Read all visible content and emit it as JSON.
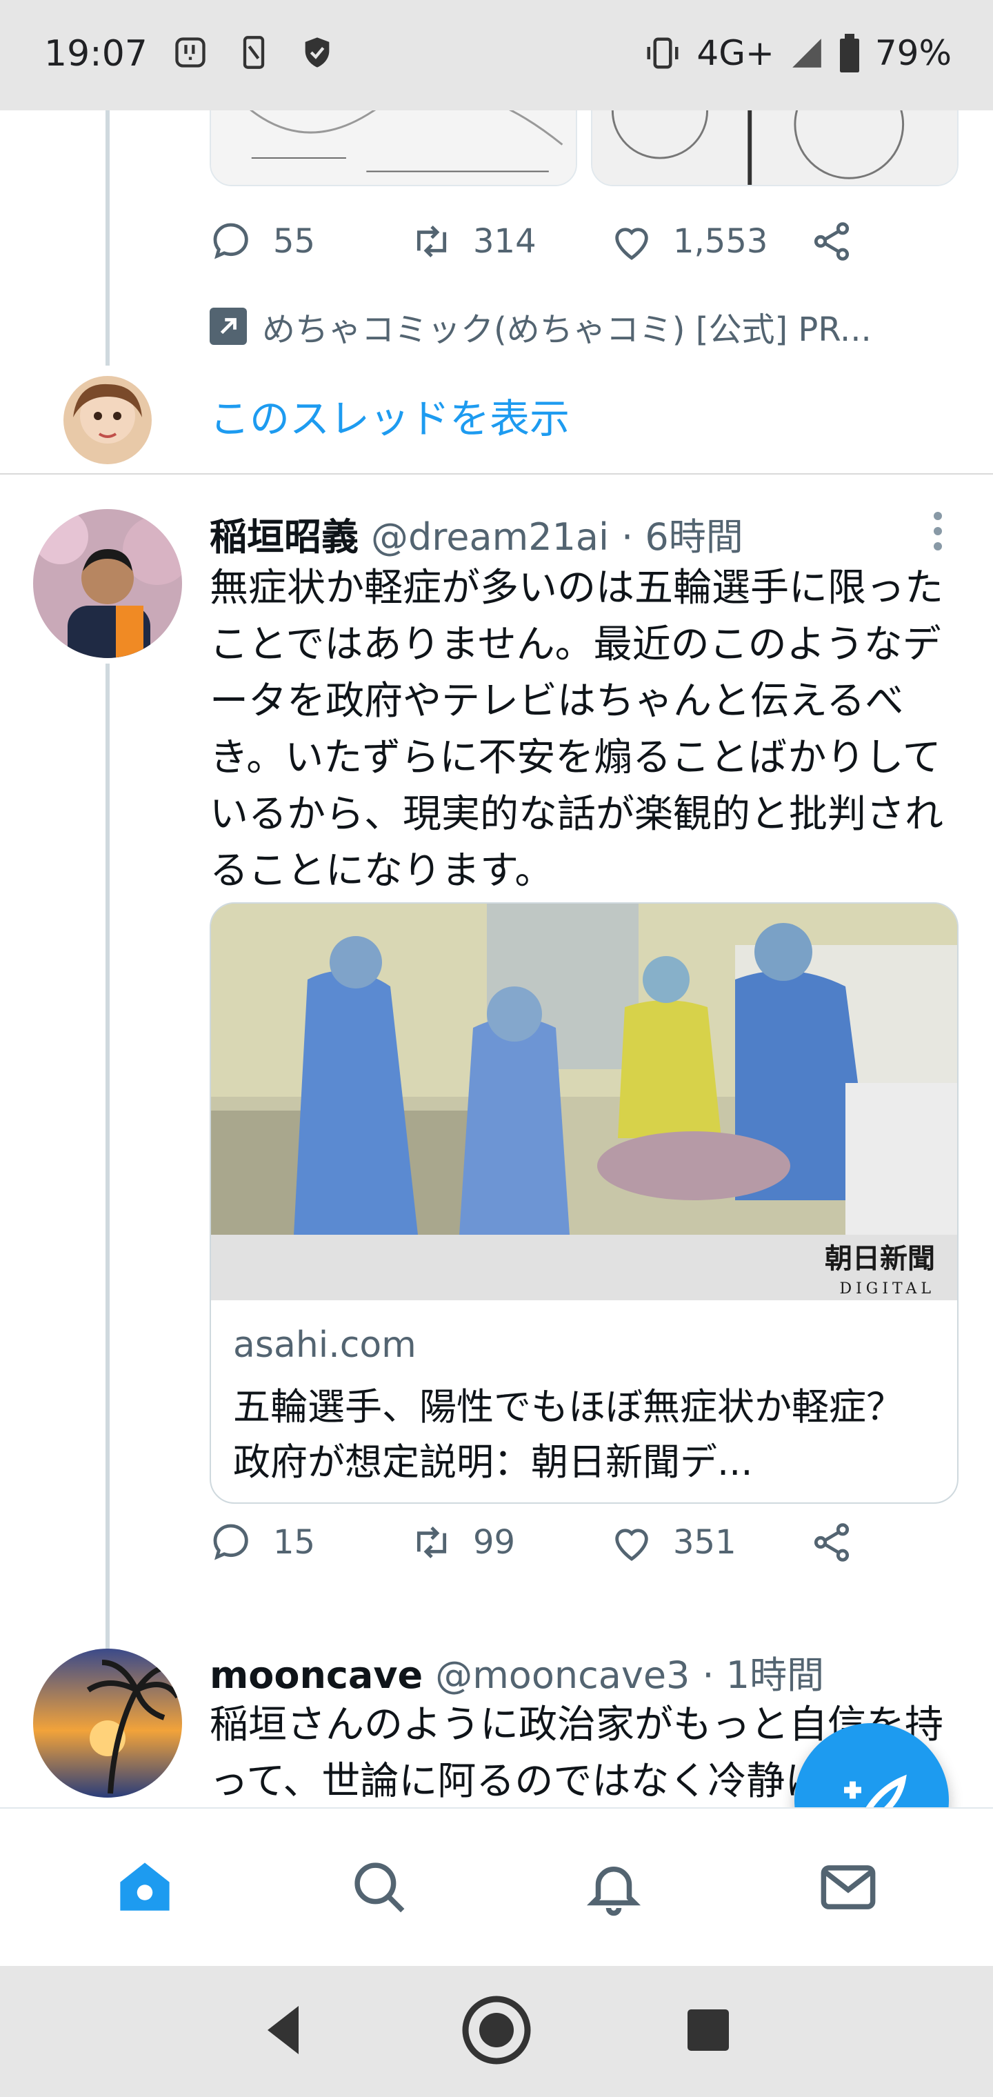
{
  "status_bar": {
    "time": "19:07",
    "network": "4G+",
    "battery": "79%",
    "left_icons": [
      "notification-icon",
      "sim-icon",
      "shield-icon"
    ],
    "right_icons": [
      "vibrate-icon",
      "signal-icon",
      "battery-icon"
    ]
  },
  "prev_tweet": {
    "replies": "55",
    "retweets": "314",
    "likes": "1,553",
    "promoted_by": "めちゃコミック(めちゃコミ) [公式] PR...",
    "show_thread": "このスレッドを表示"
  },
  "tweet": {
    "name": "稲垣昭義",
    "handle": "@dream21ai",
    "time": "· 6時間",
    "text": "無症状か軽症が多いのは五輪選手に限ったことではありません。最近のこのようなデータを政府やテレビはちゃんと伝えるべき。いたずらに不安を煽ることばかりしているから、現実的な話が楽観的と批判されることになります。",
    "card": {
      "image_watermark_line1": "朝日新聞",
      "image_watermark_line2": "DIGITAL",
      "domain": "asahi.com",
      "title": "五輪選手、陽性でもほぼ無症状か軽症？　政府が想定説明：朝日新聞デ..."
    },
    "replies": "15",
    "retweets": "99",
    "likes": "351"
  },
  "reply_tweet": {
    "name": "mooncave",
    "handle": "@mooncave3",
    "time": "· 1時間",
    "text": "稲垣さんのように政治家がもっと自信を持って、世論に阿るのではなく冷静にコ"
  },
  "colors": {
    "accent": "#1d9bf0",
    "muted": "#536471",
    "thread_line": "#cfd9de"
  },
  "bottom_nav": [
    "home-icon",
    "search-icon",
    "notifications-icon",
    "messages-icon"
  ],
  "system_nav": [
    "back-icon",
    "home-button-icon",
    "recents-icon"
  ]
}
